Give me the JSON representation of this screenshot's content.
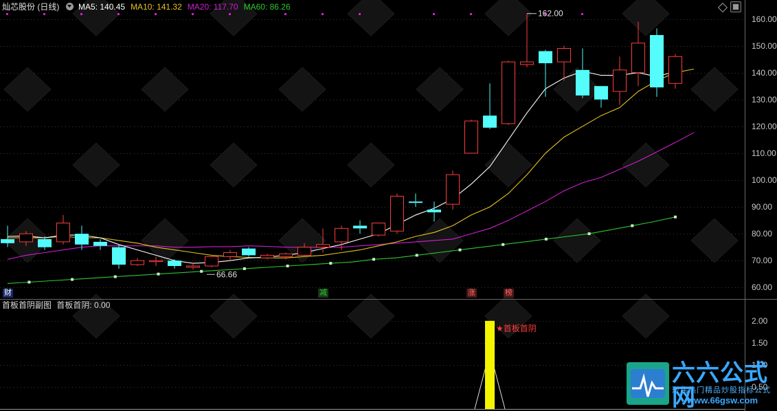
{
  "header": {
    "stock_name": "灿芯股份 (日线)",
    "ma_items": [
      {
        "label": "MA5: 140.45",
        "color": "#ffffff"
      },
      {
        "label": "MA10: 141.32",
        "color": "#e8c31e"
      },
      {
        "label": "MA20: 117.70",
        "color": "#d21ed2"
      },
      {
        "label": "MA60: 86.26",
        "color": "#2ec82e"
      }
    ]
  },
  "sub_header": {
    "title": "首板首阴副图",
    "value": "首板首阴: 0.00"
  },
  "annotations": {
    "high": "162.00",
    "low": "66.66",
    "signal": "首板首阴"
  },
  "markers": [
    {
      "text": "财",
      "color": "#ffffff",
      "bg": "#1a2a6a",
      "day": 0
    },
    {
      "text": "减",
      "color": "#2ec82e",
      "bg": "#183818",
      "day": 17
    },
    {
      "text": "涨",
      "color": "#ff6a6a",
      "bg": "#4a1818",
      "day": 25
    },
    {
      "text": "榜",
      "color": "#ff6a6a",
      "bg": "#4a1818",
      "day": 27
    }
  ],
  "watermark": {
    "cn": "六六公式网",
    "sub": "聚焦热门精品炒股指标公式",
    "url": "www.66gsw.com"
  },
  "chart_data": {
    "type": "candlestick",
    "ylim": [
      57,
      165
    ],
    "y_ticks": [
      60,
      70,
      80,
      90,
      100,
      110,
      120,
      130,
      140,
      150,
      160
    ],
    "candles": [
      {
        "o": 78,
        "c": 76.5,
        "h": 83,
        "l": 75
      },
      {
        "o": 77,
        "c": 80,
        "h": 81,
        "l": 75.5
      },
      {
        "o": 78,
        "c": 75,
        "h": 79,
        "l": 74
      },
      {
        "o": 77,
        "c": 84,
        "h": 87,
        "l": 76
      },
      {
        "o": 80,
        "c": 76,
        "h": 83,
        "l": 74
      },
      {
        "o": 77,
        "c": 75.5,
        "h": 78,
        "l": 74
      },
      {
        "o": 75,
        "c": 68.5,
        "h": 76,
        "l": 67
      },
      {
        "o": 68.5,
        "c": 70,
        "h": 71,
        "l": 68
      },
      {
        "o": 70,
        "c": 70,
        "h": 71.5,
        "l": 68
      },
      {
        "o": 70,
        "c": 68,
        "h": 70.5,
        "l": 67
      },
      {
        "o": 67.5,
        "c": 68,
        "h": 69,
        "l": 66.66
      },
      {
        "o": 68,
        "c": 71.5,
        "h": 72,
        "l": 67.5
      },
      {
        "o": 71.5,
        "c": 73,
        "h": 74,
        "l": 70
      },
      {
        "o": 74.5,
        "c": 72,
        "h": 75,
        "l": 71.5
      },
      {
        "o": 71,
        "c": 72,
        "h": 72.5,
        "l": 70.5
      },
      {
        "o": 71.5,
        "c": 72.5,
        "h": 73,
        "l": 70.5
      },
      {
        "o": 72,
        "c": 75,
        "h": 76.5,
        "l": 71.5
      },
      {
        "o": 75,
        "c": 76,
        "h": 82,
        "l": 73
      },
      {
        "o": 77,
        "c": 82,
        "h": 83,
        "l": 74
      },
      {
        "o": 83,
        "c": 82,
        "h": 85,
        "l": 80
      },
      {
        "o": 79.5,
        "c": 84,
        "h": 84,
        "l": 79
      },
      {
        "o": 81,
        "c": 94,
        "h": 95,
        "l": 80
      },
      {
        "o": 92,
        "c": 91.5,
        "h": 95,
        "l": 90
      },
      {
        "o": 89,
        "c": 88,
        "h": 92,
        "l": 84.5
      },
      {
        "o": 91,
        "c": 102,
        "h": 103.5,
        "l": 89
      },
      {
        "o": 110,
        "c": 122,
        "h": 122.5,
        "l": 110
      },
      {
        "o": 124,
        "c": 119.5,
        "h": 136,
        "l": 119
      },
      {
        "o": 121,
        "c": 144,
        "h": 144.5,
        "l": 120.5
      },
      {
        "o": 143,
        "c": 144,
        "h": 162,
        "l": 142
      },
      {
        "o": 148,
        "c": 143.5,
        "h": 148.5,
        "l": 131
      },
      {
        "o": 144,
        "c": 149,
        "h": 150,
        "l": 137
      },
      {
        "o": 141,
        "c": 131.5,
        "h": 149,
        "l": 130.5
      },
      {
        "o": 135,
        "c": 130,
        "h": 135,
        "l": 127
      },
      {
        "o": 133,
        "c": 141,
        "h": 146,
        "l": 128
      },
      {
        "o": 140,
        "c": 151,
        "h": 159,
        "l": 135
      },
      {
        "o": 154,
        "c": 134.5,
        "h": 156.5,
        "l": 131
      },
      {
        "o": 136,
        "c": 146,
        "h": 147,
        "l": 134
      }
    ],
    "ma5": [
      79,
      79.2,
      78.5,
      79.5,
      79.5,
      78.5,
      76,
      74,
      72,
      70,
      69,
      69.3,
      70,
      71,
      71.3,
      72,
      73,
      74.5,
      76,
      78,
      80,
      83.5,
      87,
      89.5,
      93,
      98.5,
      105,
      115,
      125,
      134,
      138,
      140.5,
      139,
      139,
      140,
      138.5,
      140.45
    ],
    "ma10": [
      78.5,
      78.5,
      78.5,
      79,
      78.5,
      78.5,
      77.5,
      76.5,
      75,
      74,
      73,
      72,
      71.5,
      71.2,
      71,
      71,
      71.5,
      72,
      73,
      74,
      75.5,
      77,
      79,
      80.5,
      83,
      87,
      90,
      95,
      102,
      110,
      116,
      120,
      124,
      127,
      133,
      137,
      140,
      141.32
    ],
    "ma20": [
      70.5,
      72,
      73,
      74,
      75,
      75.5,
      75.5,
      75.5,
      75.5,
      75,
      75,
      75.2,
      75.2,
      75.5,
      75.3,
      75,
      75,
      75,
      75,
      75.5,
      76,
      76.5,
      77,
      77.5,
      78,
      80,
      82,
      85,
      88.5,
      92,
      96,
      99,
      101,
      104,
      107,
      110.5,
      114,
      117.7
    ],
    "ma60": [
      61.5,
      62,
      62.5,
      63,
      63.5,
      64,
      64.5,
      65,
      65.5,
      66,
      66.5,
      67,
      67.5,
      68,
      68.5,
      69,
      69.5,
      70.5,
      71,
      72,
      73,
      74,
      75,
      76,
      77,
      78,
      79,
      80,
      81.5,
      83,
      84.5,
      86.26
    ],
    "sub": {
      "ylim": [
        0,
        2.2
      ],
      "y_ticks": [
        0.5,
        1.0,
        1.5,
        2.0
      ],
      "signal_day": 26,
      "signal_value": 2.0
    }
  }
}
